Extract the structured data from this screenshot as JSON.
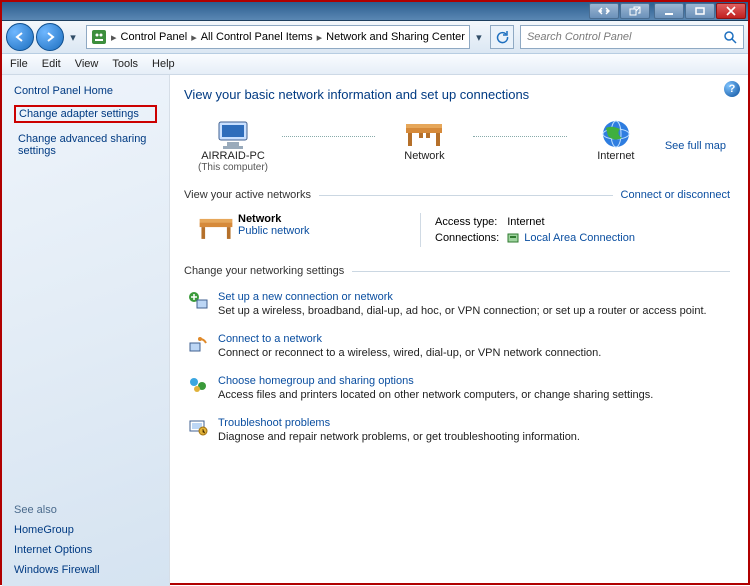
{
  "titlebar": {
    "buttons": [
      "drag",
      "undock",
      "minimize",
      "maximize",
      "close"
    ]
  },
  "address": {
    "crumbs": [
      "Control Panel",
      "All Control Panel Items",
      "Network and Sharing Center"
    ],
    "search_placeholder": "Search Control Panel"
  },
  "menu": [
    "File",
    "Edit",
    "View",
    "Tools",
    "Help"
  ],
  "sidebar": {
    "home": "Control Panel Home",
    "tasks": [
      {
        "label": "Change adapter settings",
        "highlight": true
      },
      {
        "label": "Change advanced sharing settings",
        "highlight": false
      }
    ],
    "seealso_header": "See also",
    "seealso": [
      "HomeGroup",
      "Internet Options",
      "Windows Firewall"
    ]
  },
  "page": {
    "title": "View your basic network information and set up connections",
    "nodes": {
      "computer": {
        "name": "AIRRAID-PC",
        "sub": "(This computer)"
      },
      "network": {
        "name": "Network"
      },
      "internet": {
        "name": "Internet"
      }
    },
    "full_map": "See full map",
    "active_header": "View your active networks",
    "active_link": "Connect or disconnect",
    "active_net": {
      "name": "Network",
      "type": "Public network",
      "access_label": "Access type:",
      "access_value": "Internet",
      "conn_label": "Connections:",
      "conn_value": "Local Area Connection"
    },
    "change_header": "Change your networking settings",
    "tasks": [
      {
        "icon": "new-connection",
        "title": "Set up a new connection or network",
        "desc": "Set up a wireless, broadband, dial-up, ad hoc, or VPN connection; or set up a router or access point."
      },
      {
        "icon": "connect",
        "title": "Connect to a network",
        "desc": "Connect or reconnect to a wireless, wired, dial-up, or VPN network connection."
      },
      {
        "icon": "homegroup",
        "title": "Choose homegroup and sharing options",
        "desc": "Access files and printers located on other network computers, or change sharing settings."
      },
      {
        "icon": "troubleshoot",
        "title": "Troubleshoot problems",
        "desc": "Diagnose and repair network problems, or get troubleshooting information."
      }
    ]
  }
}
